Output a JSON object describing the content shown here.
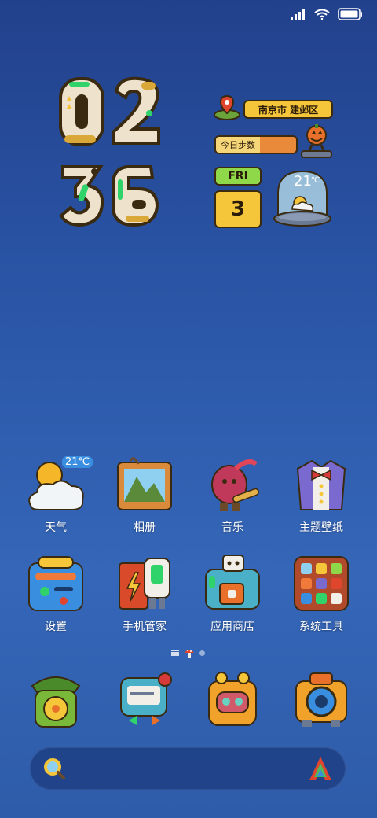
{
  "status_bar": {
    "signal_icon": "signal-icon",
    "wifi_icon": "wifi-icon",
    "battery_icon": "battery-icon"
  },
  "clock": {
    "hours": "02",
    "minutes": "36"
  },
  "location": {
    "label": "南京市 建邺区"
  },
  "steps": {
    "label": "今日步数"
  },
  "date": {
    "weekday": "FRI",
    "day": "3"
  },
  "weather_widget": {
    "temp": "21",
    "unit": "℃"
  },
  "apps": [
    {
      "label": "天气",
      "icon": "weather-icon",
      "temp": "21℃"
    },
    {
      "label": "相册",
      "icon": "gallery-icon"
    },
    {
      "label": "音乐",
      "icon": "music-icon"
    },
    {
      "label": "主题壁纸",
      "icon": "themes-icon"
    },
    {
      "label": "设置",
      "icon": "settings-icon"
    },
    {
      "label": "手机管家",
      "icon": "security-icon"
    },
    {
      "label": "应用商店",
      "icon": "app-store-icon"
    },
    {
      "label": "系统工具",
      "icon": "system-tools-icon"
    }
  ],
  "dock": [
    {
      "icon": "phone-icon"
    },
    {
      "icon": "messages-icon"
    },
    {
      "icon": "contacts-icon"
    },
    {
      "icon": "camera-icon"
    }
  ],
  "search": {
    "search_icon": "search-icon",
    "assistant_icon": "assistant-icon"
  }
}
